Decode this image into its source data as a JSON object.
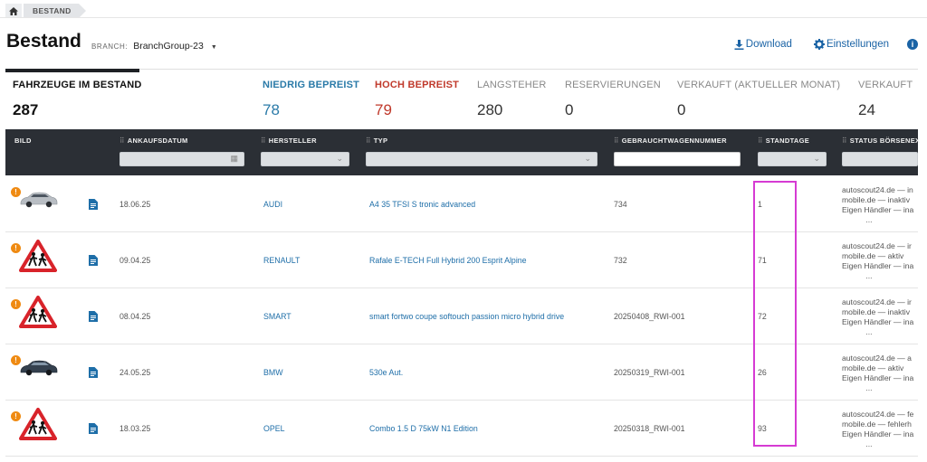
{
  "breadcrumb": {
    "label": "BESTAND"
  },
  "header": {
    "title": "Bestand",
    "branch_label": "BRANCH:",
    "branch_value": "BranchGroup-23",
    "download_label": "Download",
    "settings_label": "Einstellungen"
  },
  "stats": [
    {
      "label": "FAHRZEUGE IM BESTAND",
      "value": "287"
    },
    {
      "label": "NIEDRIG BEPREIST",
      "value": "78"
    },
    {
      "label": "HOCH BEPREIST",
      "value": "79"
    },
    {
      "label": "LANGSTEHER",
      "value": "280"
    },
    {
      "label": "RESERVIERUNGEN",
      "value": "0"
    },
    {
      "label": "VERKAUFT (AKTUELLER MONAT)",
      "value": "0"
    },
    {
      "label": "VERKAUFT",
      "value": "24"
    }
  ],
  "table": {
    "columns": {
      "bild": "BILD",
      "ankaufsdatum": "ANKAUFSDATUM",
      "hersteller": "HERSTELLER",
      "typ": "TYP",
      "gebrauchtwagennummer": "GEBRAUCHTWAGENNUMMER",
      "standtage": "STANDTAGE",
      "status": "STATUS BÖRSENEX"
    },
    "rows": [
      {
        "image": "car-silver",
        "ankaufsdatum": "18.06.25",
        "hersteller": "AUDI",
        "typ": "A4 35 TFSI S tronic advanced",
        "nummer": "734",
        "standtage": "1",
        "status": [
          "autoscout24.de — in",
          "mobile.de — inaktiv",
          "Eigen Händler — ina",
          "..."
        ]
      },
      {
        "image": "warning-sign",
        "ankaufsdatum": "09.04.25",
        "hersteller": "RENAULT",
        "typ": "Rafale E-TECH Full Hybrid 200 Esprit Alpine",
        "nummer": "732",
        "standtage": "71",
        "status": [
          "autoscout24.de — ir",
          "mobile.de — aktiv",
          "Eigen Händler — ina",
          "..."
        ]
      },
      {
        "image": "warning-sign",
        "ankaufsdatum": "08.04.25",
        "hersteller": "SMART",
        "typ": "smart fortwo coupe softouch passion micro hybrid drive",
        "nummer": "20250408_RWI-001",
        "standtage": "72",
        "status": [
          "autoscout24.de — ir",
          "mobile.de — inaktiv",
          "Eigen Händler — ina",
          "..."
        ]
      },
      {
        "image": "car-dark",
        "ankaufsdatum": "24.05.25",
        "hersteller": "BMW",
        "typ": "530e Aut.",
        "nummer": "20250319_RWI-001",
        "standtage": "26",
        "status": [
          "autoscout24.de — a",
          "mobile.de — aktiv",
          "Eigen Händler — ina",
          "..."
        ]
      },
      {
        "image": "warning-sign",
        "ankaufsdatum": "18.03.25",
        "hersteller": "OPEL",
        "typ": "Combo 1.5 D 75kW N1 Edition",
        "nummer": "20250318_RWI-001",
        "standtage": "93",
        "status": [
          "autoscout24.de — fe",
          "mobile.de — fehlerh",
          "Eigen Händler — ina",
          "..."
        ]
      }
    ]
  },
  "colors": {
    "accent": "#1a63a5",
    "low": "#2a7aa8",
    "high": "#c0392b",
    "warning": "#ef8a12",
    "highlight": "#d63bd3",
    "header_bg": "#2b2f35"
  }
}
